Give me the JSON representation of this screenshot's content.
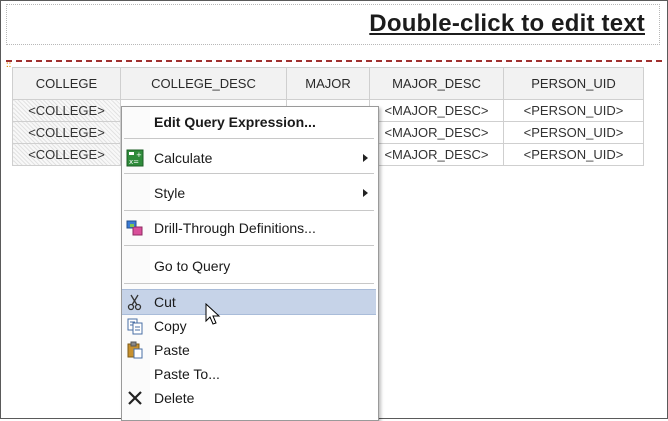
{
  "title": "Double-click to edit text",
  "table": {
    "headers": [
      "COLLEGE",
      "COLLEGE_DESC",
      "MAJOR",
      "MAJOR_DESC",
      "PERSON_UID"
    ],
    "rows": [
      [
        "<COLLEGE>",
        "",
        "",
        "<MAJOR_DESC>",
        "<PERSON_UID>"
      ],
      [
        "<COLLEGE>",
        "",
        "",
        "<MAJOR_DESC>",
        "<PERSON_UID>"
      ],
      [
        "<COLLEGE>",
        "",
        "",
        "<MAJOR_DESC>",
        "<PERSON_UID>"
      ]
    ]
  },
  "context_menu": {
    "edit_query_expression": "Edit Query Expression...",
    "calculate": "Calculate",
    "style": "Style",
    "drill_through": "Drill-Through Definitions...",
    "go_to_query": "Go to Query",
    "cut": "Cut",
    "copy": "Copy",
    "paste": "Paste",
    "paste_to": "Paste To...",
    "delete": "Delete"
  },
  "icons": {
    "calculate": "calculator-icon",
    "drill_through": "drill-through-icon",
    "cut": "scissors-icon",
    "copy": "copy-icon",
    "paste": "paste-icon",
    "delete": "delete-x-icon"
  },
  "colors": {
    "highlight": "#c6d3e8",
    "drag_border": "#a0302e",
    "header_bg": "#f2f2f2"
  }
}
